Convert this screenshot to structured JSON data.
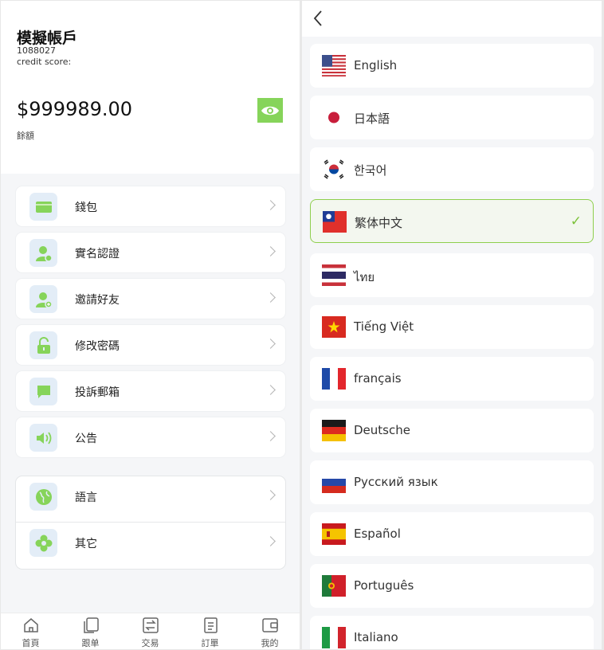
{
  "account": {
    "name": "模擬帳戶",
    "id": "1088027",
    "credit_score_label": "credit score:",
    "balance": "$999989.00",
    "balance_label": "餘額"
  },
  "menu": {
    "items": [
      {
        "label": "錢包",
        "icon": "wallet-icon"
      },
      {
        "label": "實名認證",
        "icon": "user-verify-icon"
      },
      {
        "label": "邀請好友",
        "icon": "invite-user-icon"
      },
      {
        "label": "修改密碼",
        "icon": "lock-icon"
      },
      {
        "label": "投訴郵箱",
        "icon": "message-icon"
      },
      {
        "label": "公告",
        "icon": "speaker-icon"
      }
    ],
    "group2": [
      {
        "label": "語言",
        "icon": "globe-icon"
      },
      {
        "label": "其它",
        "icon": "flower-icon"
      }
    ]
  },
  "tabbar": {
    "items": [
      {
        "label": "首頁",
        "icon": "home-icon"
      },
      {
        "label": "跟单",
        "icon": "copy-icon"
      },
      {
        "label": "交易",
        "icon": "exchange-icon"
      },
      {
        "label": "訂單",
        "icon": "order-icon"
      },
      {
        "label": "我的",
        "icon": "wallet-profile-icon"
      }
    ]
  },
  "languages": {
    "selected": "繁体中文",
    "items": [
      {
        "label": "English",
        "flag": "us-flag"
      },
      {
        "label": "日本語",
        "flag": "japan-flag"
      },
      {
        "label": "한국어",
        "flag": "korea-flag"
      },
      {
        "label": "繁体中文",
        "flag": "taiwan-flag"
      },
      {
        "label": "ไทย",
        "flag": "thailand-flag"
      },
      {
        "label": "Tiếng Việt",
        "flag": "vietnam-flag"
      },
      {
        "label": "français",
        "flag": "france-flag"
      },
      {
        "label": "Deutsche",
        "flag": "germany-flag"
      },
      {
        "label": "Русский язык",
        "flag": "russia-flag"
      },
      {
        "label": "Español",
        "flag": "spain-flag"
      },
      {
        "label": "Português",
        "flag": "portugal-flag"
      },
      {
        "label": "Italiano",
        "flag": "italy-flag"
      }
    ]
  },
  "colors": {
    "accent": "#86d45a",
    "icon_bg": "#e3edf7",
    "selected_border": "#8fcf4e"
  }
}
